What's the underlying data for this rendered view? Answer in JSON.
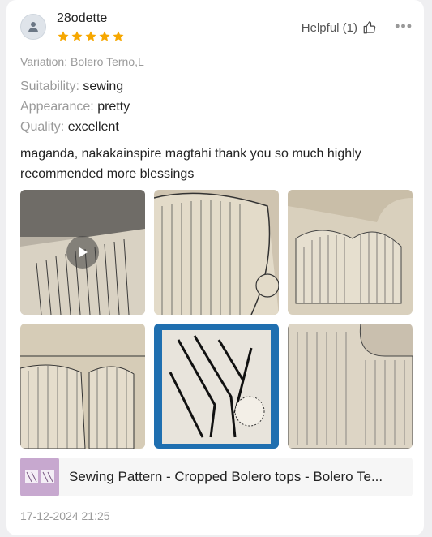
{
  "review": {
    "username": "28odette",
    "rating": 5,
    "helpful_label": "Helpful (1)",
    "more_label": "•••",
    "variation": "Variation: Bolero Terno,L",
    "attributes": [
      {
        "key": "Suitability: ",
        "value": "sewing"
      },
      {
        "key": "Appearance: ",
        "value": "pretty"
      },
      {
        "key": "Quality: ",
        "value": "excellent"
      }
    ],
    "text": "maganda, nakakainspire magtahi thank you so much highly recommended more blessings",
    "media_count": 6,
    "product_title": "Sewing Pattern - Cropped Bolero tops - Bolero Te...",
    "date": "17-12-2024 21:25"
  },
  "colors": {
    "star": "#f6a700",
    "muted_text": "#9a9a9a",
    "product_thumb": "#c7a8cf"
  },
  "icons": [
    "user-icon",
    "star-icon",
    "thumbs-up-icon",
    "more-icon",
    "play-icon"
  ]
}
